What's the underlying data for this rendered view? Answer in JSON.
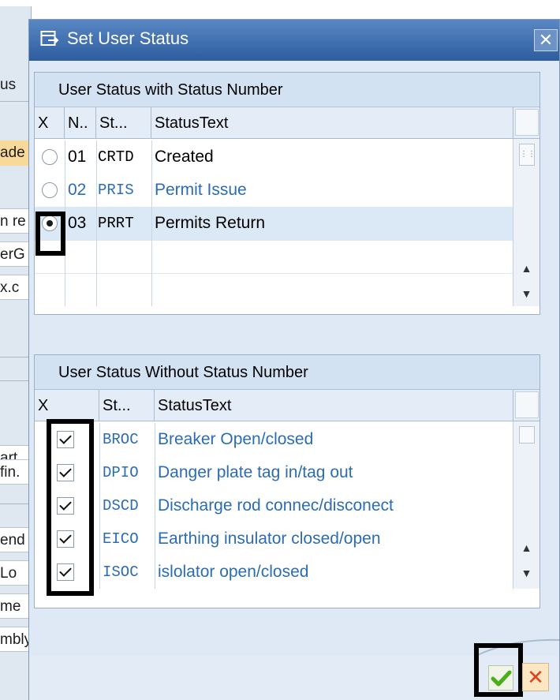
{
  "background_app": {
    "rows": [
      "us",
      "ade",
      "n re",
      "erG",
      "x.c",
      "art",
      "fin.",
      "end",
      "Lo",
      "me",
      "mbly"
    ]
  },
  "dialog": {
    "title": "Set User Status",
    "close_label": "✕",
    "status_with_number": {
      "title": "User Status with Status Number",
      "columns": [
        "X",
        "N..",
        "St...",
        "StatusText"
      ],
      "rows": [
        {
          "selected": false,
          "number": "01",
          "code": "CRTD",
          "text": "Created"
        },
        {
          "selected": false,
          "number": "02",
          "code": "PRIS",
          "text": "Permit Issue"
        },
        {
          "selected": true,
          "number": "03",
          "code": "PRRT",
          "text": "Permits Return"
        }
      ]
    },
    "status_without_number": {
      "title": "User Status Without Status Number",
      "columns": [
        "X",
        "St...",
        "StatusText"
      ],
      "rows": [
        {
          "checked": true,
          "code": "BROC",
          "text": "Breaker Open/closed"
        },
        {
          "checked": true,
          "code": "DPIO",
          "text": "Danger plate tag in/tag out"
        },
        {
          "checked": true,
          "code": "DSCD",
          "text": "Discharge rod connec/disconect"
        },
        {
          "checked": true,
          "code": "EICO",
          "text": "Earthing insulator closed/open"
        },
        {
          "checked": true,
          "code": "ISOC",
          "text": "islolator open/closed"
        }
      ]
    },
    "buttons": {
      "ok": "continue-icon",
      "cancel": "✕"
    }
  },
  "colors": {
    "title_bar": "#2d5d9f",
    "link_text": "#2b6cb3",
    "highlight_frame": "#000000",
    "ok_check": "#4caf1a",
    "cancel_x": "#e3401b"
  }
}
